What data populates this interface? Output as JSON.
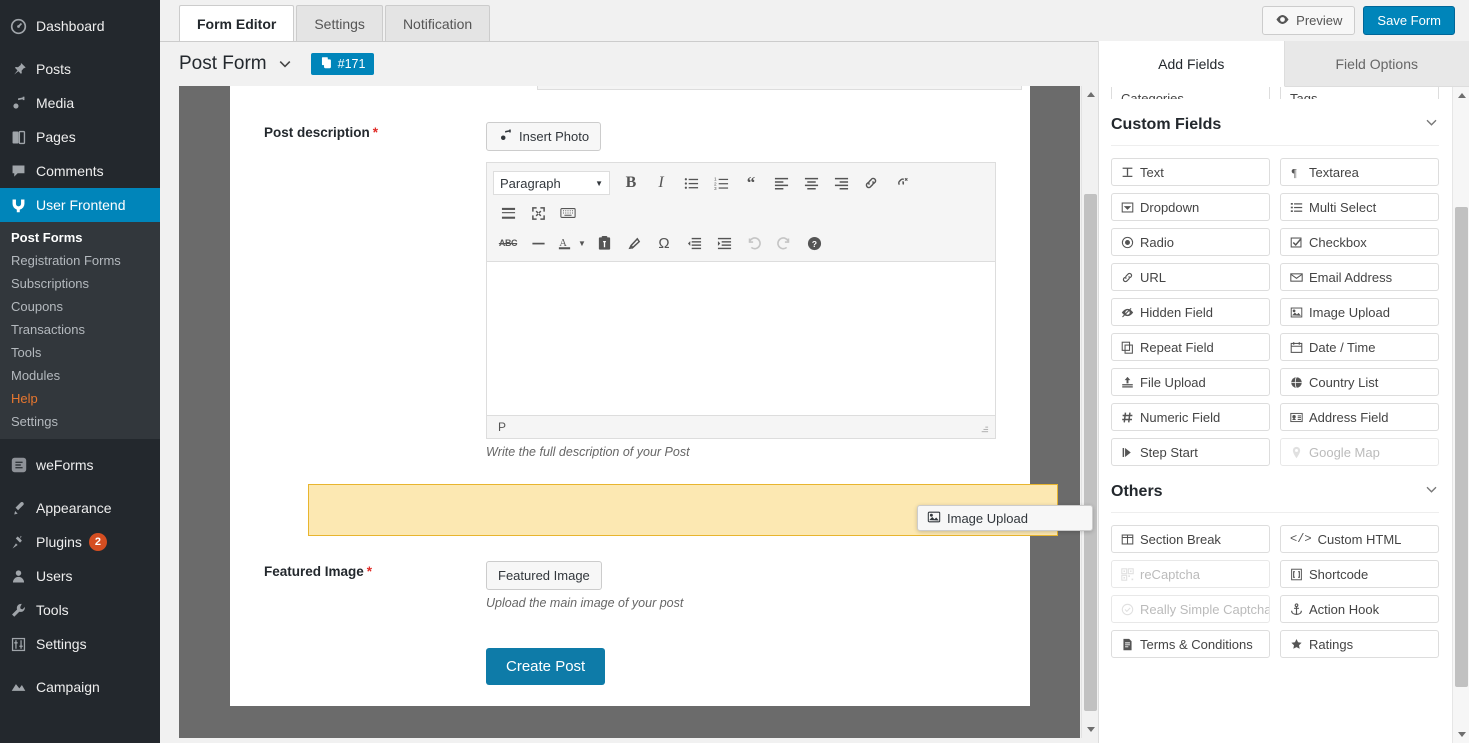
{
  "sidebar": {
    "items": [
      {
        "label": "Dashboard",
        "icon": "dashboard-icon"
      },
      {
        "label": "Posts",
        "icon": "pin-icon"
      },
      {
        "label": "Media",
        "icon": "media-icon"
      },
      {
        "label": "Pages",
        "icon": "pages-icon"
      },
      {
        "label": "Comments",
        "icon": "comment-icon"
      },
      {
        "label": "User Frontend",
        "icon": "user-frontend-icon",
        "active": true
      }
    ],
    "submenu": [
      {
        "label": "Post Forms",
        "current": true
      },
      {
        "label": "Registration Forms"
      },
      {
        "label": "Subscriptions"
      },
      {
        "label": "Coupons"
      },
      {
        "label": "Transactions"
      },
      {
        "label": "Tools"
      },
      {
        "label": "Modules"
      },
      {
        "label": "Help",
        "highlight": true
      },
      {
        "label": "Settings"
      }
    ],
    "items2": [
      {
        "label": "weForms",
        "icon": "weforms-icon"
      },
      {
        "label": "Appearance",
        "icon": "brush-icon"
      },
      {
        "label": "Plugins",
        "icon": "plug-icon",
        "count": "2"
      },
      {
        "label": "Users",
        "icon": "user-icon"
      },
      {
        "label": "Tools",
        "icon": "wrench-icon"
      },
      {
        "label": "Settings",
        "icon": "settings-icon"
      },
      {
        "label": "Campaign",
        "icon": "campaign-icon"
      }
    ]
  },
  "topbar": {
    "tabs": [
      {
        "label": "Form Editor",
        "active": true
      },
      {
        "label": "Settings",
        "active": false
      },
      {
        "label": "Notification",
        "active": false
      }
    ],
    "preview_label": "Preview",
    "save_label": "Save Form"
  },
  "form_header": {
    "title": "Post Form",
    "id_badge": "#171"
  },
  "canvas": {
    "post_description": {
      "label": "Post description",
      "required": "*",
      "insert_photo_label": "Insert Photo",
      "format_select": "Paragraph",
      "status_path": "P",
      "description": "Write the full description of your Post"
    },
    "featured_image": {
      "label": "Featured Image",
      "required": "*",
      "button_label": "Featured Image",
      "description": "Upload the main image of your post"
    },
    "submit_label": "Create Post"
  },
  "drag_ghost": {
    "label": "Image Upload"
  },
  "right_panel": {
    "tabs": [
      {
        "label": "Add Fields",
        "active": true
      },
      {
        "label": "Field Options",
        "active": false
      }
    ],
    "post_fields_partial": [
      {
        "label": "Categories"
      },
      {
        "label": "Tags"
      }
    ],
    "sections": [
      {
        "title": "Custom Fields",
        "fields": [
          {
            "label": "Text",
            "icon": "text-icon",
            "disabled": false
          },
          {
            "label": "Textarea",
            "icon": "paragraph-icon",
            "disabled": false
          },
          {
            "label": "Dropdown",
            "icon": "dropdown-icon",
            "disabled": false
          },
          {
            "label": "Multi Select",
            "icon": "list-icon",
            "disabled": false
          },
          {
            "label": "Radio",
            "icon": "radio-icon",
            "disabled": false
          },
          {
            "label": "Checkbox",
            "icon": "checkbox-icon",
            "disabled": false
          },
          {
            "label": "URL",
            "icon": "link-icon",
            "disabled": false
          },
          {
            "label": "Email Address",
            "icon": "envelope-icon",
            "disabled": false
          },
          {
            "label": "Hidden Field",
            "icon": "eye-slash-icon",
            "disabled": false
          },
          {
            "label": "Image Upload",
            "icon": "image-icon",
            "disabled": false
          },
          {
            "label": "Repeat Field",
            "icon": "copy-icon",
            "disabled": false
          },
          {
            "label": "Date / Time",
            "icon": "calendar-icon",
            "disabled": false
          },
          {
            "label": "File Upload",
            "icon": "upload-icon",
            "disabled": false
          },
          {
            "label": "Country List",
            "icon": "globe-icon",
            "disabled": false
          },
          {
            "label": "Numeric Field",
            "icon": "hash-icon",
            "disabled": false
          },
          {
            "label": "Address Field",
            "icon": "address-card-icon",
            "disabled": false
          },
          {
            "label": "Step Start",
            "icon": "step-icon",
            "disabled": false
          },
          {
            "label": "Google Map",
            "icon": "map-marker-icon",
            "disabled": true
          }
        ]
      },
      {
        "title": "Others",
        "fields": [
          {
            "label": "Section Break",
            "icon": "columns-icon",
            "disabled": false
          },
          {
            "label": "Custom HTML",
            "icon": "code-icon",
            "disabled": false
          },
          {
            "label": "reCaptcha",
            "icon": "qrcode-icon",
            "disabled": true
          },
          {
            "label": "Shortcode",
            "icon": "shortcode-icon",
            "disabled": false
          },
          {
            "label": "Really Simple Captcha",
            "icon": "check-circle-icon",
            "disabled": true
          },
          {
            "label": "Action Hook",
            "icon": "anchor-icon",
            "disabled": false
          },
          {
            "label": "Terms & Conditions",
            "icon": "file-text-icon",
            "disabled": false
          },
          {
            "label": "Ratings",
            "icon": "star-icon",
            "disabled": false
          }
        ]
      }
    ]
  },
  "colors": {
    "accent": "#0085ba",
    "sidebar_bg": "#23282d",
    "submenu_bg": "#32373c",
    "canvas_bg": "#6b6b6b",
    "placeholder_fill": "#fce8b2",
    "placeholder_border": "#e8b52e",
    "required": "#e02b27",
    "help_highlight": "#e8772f",
    "badge": "#d54e21"
  }
}
